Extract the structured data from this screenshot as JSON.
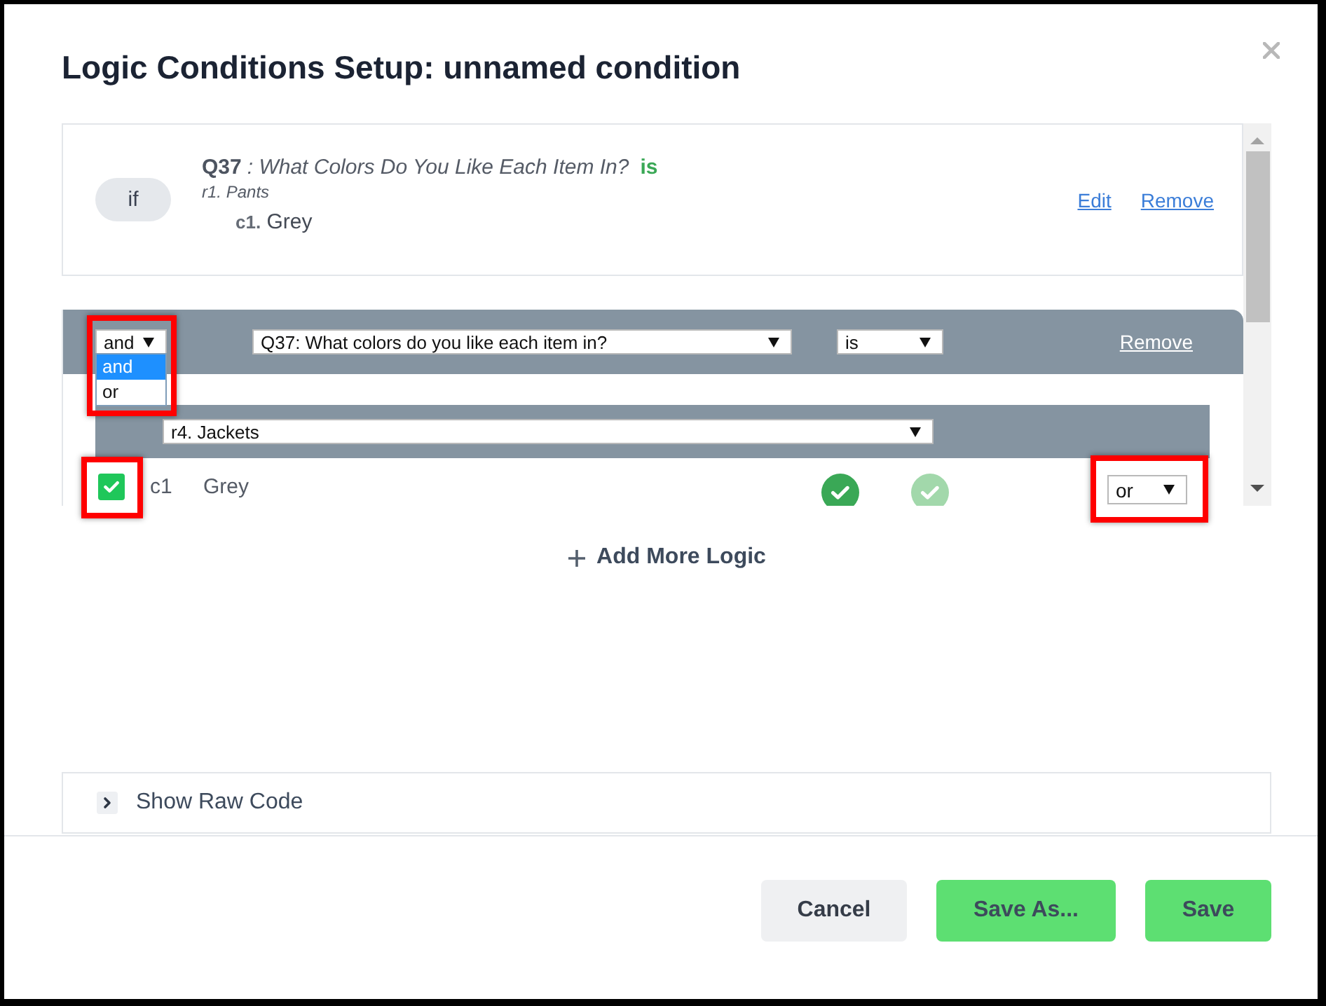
{
  "dialog": {
    "title": "Logic Conditions Setup: unnamed condition"
  },
  "condition": {
    "keyword": "if",
    "question": "Q37",
    "question_text": ": What Colors Do You Like Each Item In?",
    "operator": "is",
    "row": "r1. Pants",
    "choice": "**c1.** Grey",
    "links": [
      "Edit",
      "Remove"
    ]
  },
  "logic_block": {
    "connector": {
      "value": "and",
      "expanded": true,
      "highlighted": true,
      "options": [
        {
          "label": "and",
          "selected": true
        },
        {
          "label": "or",
          "selected": false
        }
      ]
    },
    "question_select": {
      "value": "Q37: What colors do you like each item in?"
    },
    "operator_select": {
      "value": "is"
    },
    "remove_link": "Remove",
    "row_select": {
      "value": "r4. Jackets"
    },
    "choices": [
      {
        "code": "c1",
        "label": "Grey",
        "checked": true,
        "highlighted": true,
        "indicators": [
          {
            "selected": true
          },
          {
            "selected": false
          }
        ],
        "connector": {
          "value": "or",
          "highlighted": true
        }
      }
    ]
  },
  "add_more_logic": "Add More Logic",
  "raw_code": {
    "label": "Show Raw Code",
    "expanded": false
  },
  "buttons": [
    {
      "label": "Cancel",
      "kind": "secondary"
    },
    {
      "label": "Save As...",
      "kind": "primary"
    },
    {
      "label": "Save",
      "kind": "primary"
    }
  ]
}
